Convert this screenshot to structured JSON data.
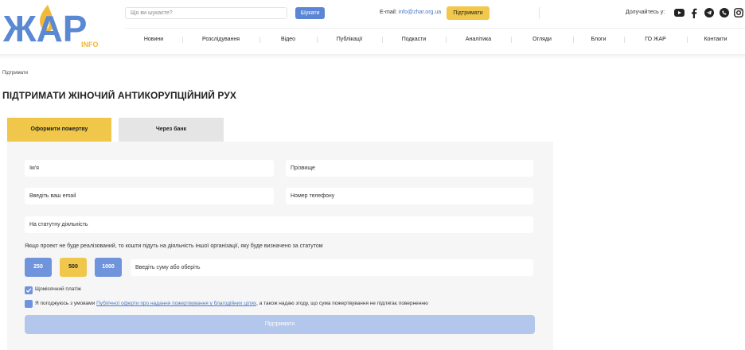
{
  "header": {
    "logo": {
      "main": "ЖАР",
      "sub": "INFO"
    },
    "search": {
      "placeholder": "Що ви шукаєте?",
      "button": "Шукати"
    },
    "email": {
      "label": "E-mail:",
      "value": "info@zhar.org.ua"
    },
    "support_button": "Підтримати",
    "join_label": "Долучайтесь у:",
    "social": [
      "youtube-icon",
      "facebook-icon",
      "telegram-icon",
      "viber-icon",
      "instagram-icon"
    ]
  },
  "nav": [
    "Новини",
    "Розслідування",
    "Відео",
    "Публікації",
    "Подкасти",
    "Аналітика",
    "Огляди",
    "Блоги",
    "ГО ЖАР",
    "Контакти"
  ],
  "breadcrumb": "Підтримати",
  "page_title": "ПІДТРИМАТИ ЖІНОЧИЙ АНТИКОРУПЦІЙНИЙ РУХ",
  "tabs": {
    "active": "Оформити пожертву",
    "bank": "Через банк"
  },
  "form": {
    "name": "Ім'я",
    "surname": "Прізвище",
    "email": "Введіть ваш email",
    "phone": "Номер телефону",
    "purpose": "На статутну діяльність",
    "note": "Якщо проект не буде реалізований, то кошти підуть на діяльність іншої організації, яку буде визначено за статутом",
    "amounts": [
      "250",
      "500",
      "1000"
    ],
    "custom_amount": "Введіть суму або оберіть",
    "monthly": "Щомісячний платіж",
    "agree_prefix": "Я погоджуюсь з умовами",
    "agree_link": "Публічної оферти про надання пожертвування у благодійних цілях",
    "agree_suffix": ", а також надаю згоду, що сума пожертвування не підлягає поверненню",
    "submit": "Підтримати"
  },
  "colors": {
    "accent_yellow": "#f0c74a",
    "accent_blue": "#6f94dc",
    "submit_disabled": "#b3c6ec",
    "panel_bg": "#f6f6f6"
  }
}
